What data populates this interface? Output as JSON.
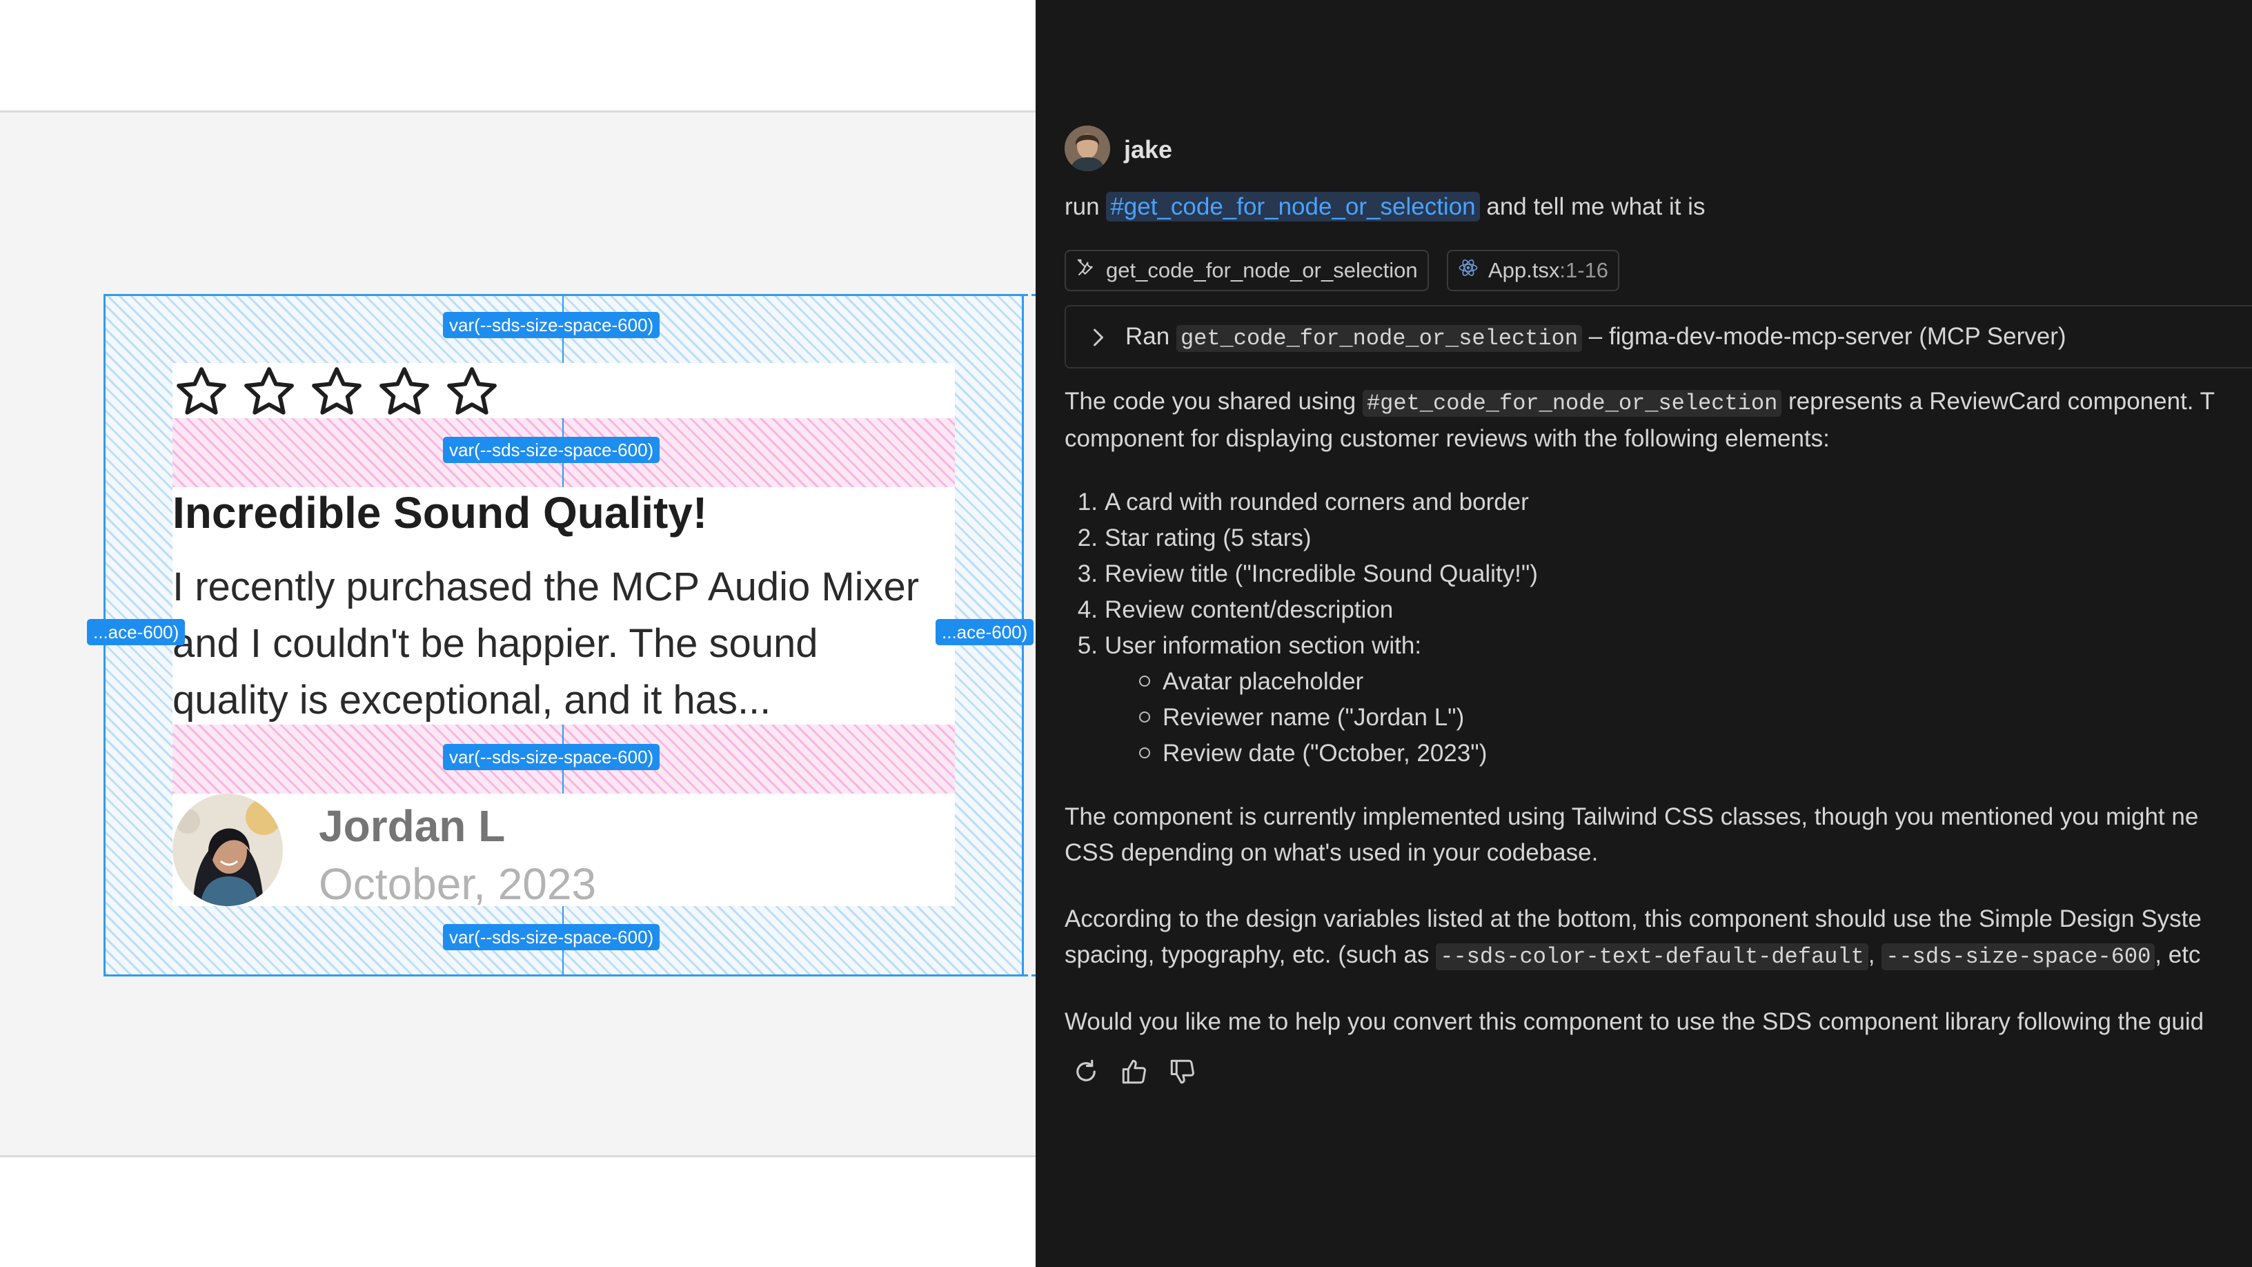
{
  "canvas": {
    "spacing_labels": {
      "top": "var(--sds-size-space-600)",
      "gap_stars": "var(--sds-size-space-600)",
      "gap_body": "var(--sds-size-space-600)",
      "bottom": "var(--sds-size-space-600)",
      "left": "...ace-600)",
      "right": "...ace-600)"
    },
    "card": {
      "rating": 5,
      "title": "Incredible Sound Quality!",
      "body": "I recently purchased the MCP Audio Mixer and I couldn't be happier. The sound quality is exceptional, and it has...",
      "reviewer_name": "Jordan L",
      "review_date": "October, 2023"
    }
  },
  "chat": {
    "user": {
      "name": "jake",
      "avatar": "user-avatar"
    },
    "message": {
      "prefix": "run",
      "mention": "#get_code_for_node_or_selection",
      "suffix": "and tell me what it is"
    },
    "references": [
      {
        "label": "get_code_for_node_or_selection",
        "icon": "tools-icon"
      },
      {
        "label": "App.tsx",
        "range": ":1-16",
        "icon": "react-icon"
      }
    ],
    "tool_call": {
      "verb": "Ran",
      "tool": "get_code_for_node_or_selection",
      "server": "– figma-dev-mode-mcp-server (MCP Server)"
    },
    "response": {
      "intro_line1_a": "The code you shared using",
      "intro_code": "#get_code_for_node_or_selection",
      "intro_line1_b": "represents a ReviewCard component. T",
      "intro_line2": "component for displaying customer reviews with the following elements:",
      "list": [
        {
          "num": "1.",
          "text": "A card with rounded corners and border"
        },
        {
          "num": "2.",
          "text": "Star rating (5 stars)"
        },
        {
          "num": "3.",
          "text": "Review title (\"Incredible Sound Quality!\")"
        },
        {
          "num": "4.",
          "text": "Review content/description"
        },
        {
          "num": "5.",
          "text": "User information section with:"
        }
      ],
      "sublist": [
        "Avatar placeholder",
        "Reviewer name (\"Jordan L\")",
        "Review date (\"October, 2023\")"
      ],
      "para2_line1": "The component is currently implemented using Tailwind CSS classes, though you mentioned you might ne",
      "para2_line2": "CSS depending on what's used in your codebase.",
      "para3_line1": "According to the design variables listed at the bottom, this component should use the Simple Design Syste",
      "para3_line2_a": "spacing, typography, etc. (such as",
      "para3_code1": "--sds-color-text-default-default",
      "para3_sep": ",",
      "para3_code2": "--sds-size-space-600",
      "para3_line2_b": ", etc",
      "para4": "Would you like me to help you convert this component to use the SDS component library following the guid"
    },
    "actions": [
      "retry-icon",
      "thumbs-up-icon",
      "thumbs-down-icon"
    ]
  },
  "colors": {
    "chat_bg": "#181818",
    "mention": "#4aa3ff",
    "spacing_badge": "#1e8df0",
    "padding_overlay": "#2f9bf0",
    "gap_overlay": "#f05abe"
  }
}
